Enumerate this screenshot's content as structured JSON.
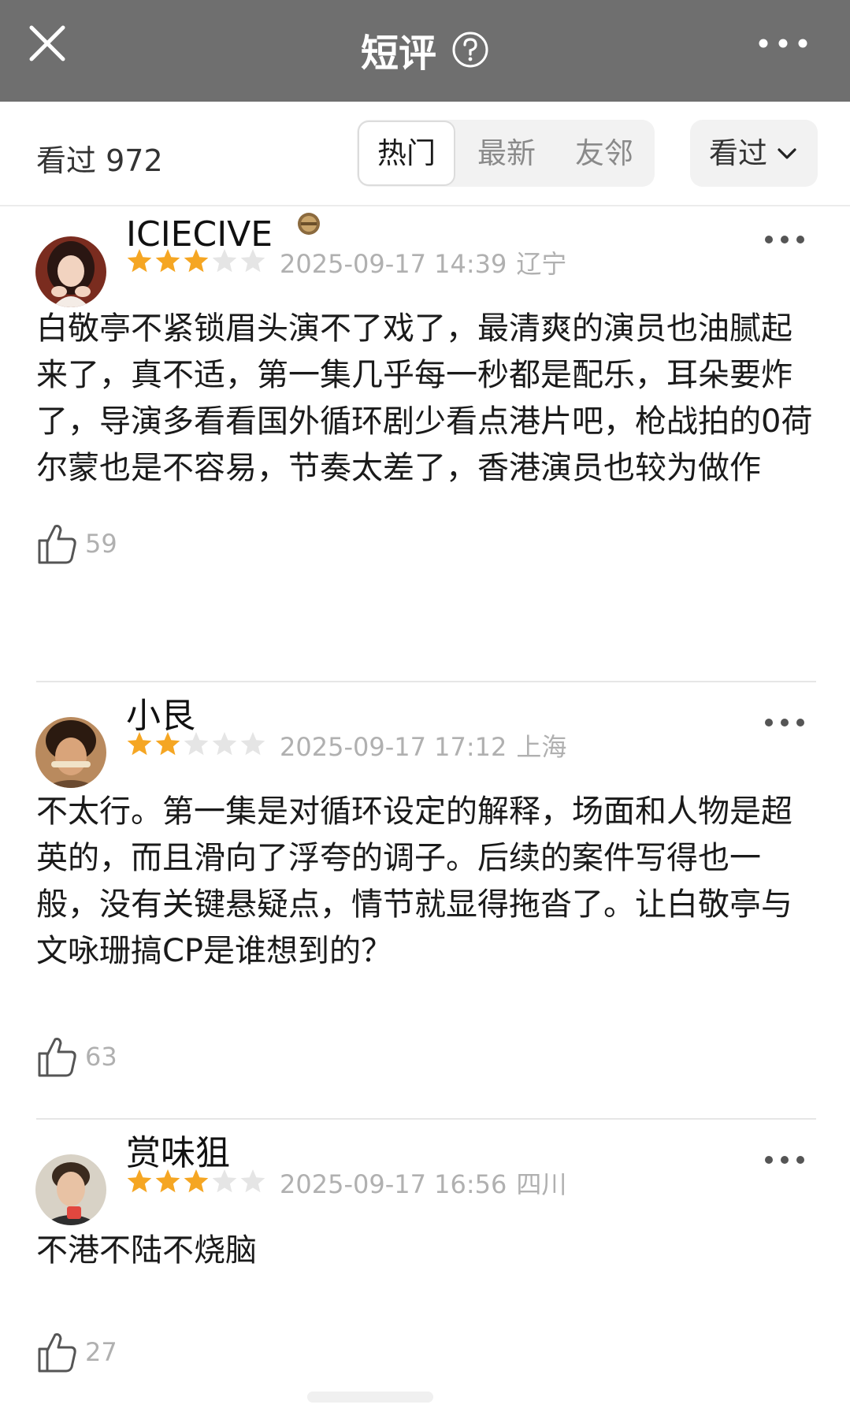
{
  "nav": {
    "title": "短评"
  },
  "toolbar": {
    "seen_label": "看过",
    "seen_count": "972",
    "tabs": [
      {
        "label": "热门",
        "active": true
      },
      {
        "label": "最新",
        "active": false
      },
      {
        "label": "友邻",
        "active": false
      }
    ],
    "filter_label": "看过"
  },
  "reviews": [
    {
      "username": "ICIECIVE",
      "rating": 3,
      "date": "2025-09-17 14:39",
      "location": "辽宁",
      "content": "白敬亭不紧锁眉头演不了戏了，最清爽的演员也油腻起来了，真不适，第一集几乎每一秒都是配乐，耳朵要炸了，导演多看看国外循环剧少看点港片吧，枪战拍的0荷尔蒙也是不容易，节奏太差了，香港演员也较为做作",
      "likes": "59"
    },
    {
      "username": "小艮",
      "rating": 2,
      "date": "2025-09-17 17:12",
      "location": "上海",
      "content": "不太行。第一集是对循环设定的解释，场面和人物是超英的，而且滑向了浮夸的调子。后续的案件写得也一般，没有关键悬疑点，情节就显得拖沓了。让白敬亭与文咏珊搞CP是谁想到的？",
      "likes": "63"
    },
    {
      "username": "赏味狙",
      "rating": 3,
      "date": "2025-09-17 16:56",
      "location": "四川",
      "content": "不港不陆不烧脑",
      "likes": "27"
    }
  ],
  "colors": {
    "nav_bg": "#6f6f6f",
    "star_filled": "#f5a623",
    "star_empty": "#e5e5e5",
    "meta_text": "#b0b0b0"
  },
  "icons": [
    "close-icon",
    "help-icon",
    "more-icon",
    "chevron-down-icon",
    "star-icon",
    "thumbs-up-icon",
    "medal-badge-icon"
  ]
}
